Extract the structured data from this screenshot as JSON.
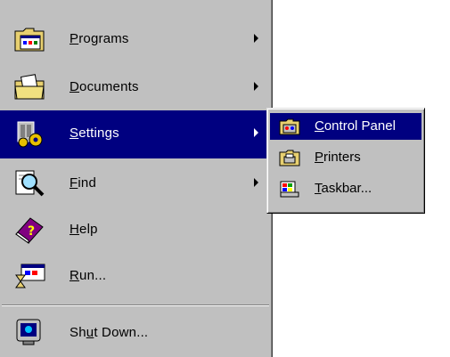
{
  "start_menu": {
    "items": [
      {
        "label": "Programs",
        "icon": "programs-folder-icon",
        "has_submenu": true
      },
      {
        "label": "Documents",
        "icon": "documents-folder-icon",
        "has_submenu": true
      },
      {
        "label": "Settings",
        "icon": "settings-icon",
        "has_submenu": true,
        "selected": true
      },
      {
        "label": "Find",
        "icon": "find-magnifier-icon",
        "has_submenu": true
      },
      {
        "label": "Help",
        "icon": "help-book-icon",
        "has_submenu": false
      },
      {
        "label": "Run...",
        "icon": "run-icon",
        "has_submenu": false
      }
    ],
    "shutdown": {
      "label": "Shut Down...",
      "icon": "shutdown-computer-icon"
    }
  },
  "settings_submenu": {
    "items": [
      {
        "label": "Control Panel",
        "icon": "control-panel-icon",
        "selected": true
      },
      {
        "label": "Printers",
        "icon": "printers-folder-icon"
      },
      {
        "label": "Taskbar...",
        "icon": "taskbar-icon"
      }
    ]
  },
  "colors": {
    "menu_face": "#c0c0c0",
    "highlight": "#000080",
    "highlight_text": "#ffffff"
  }
}
